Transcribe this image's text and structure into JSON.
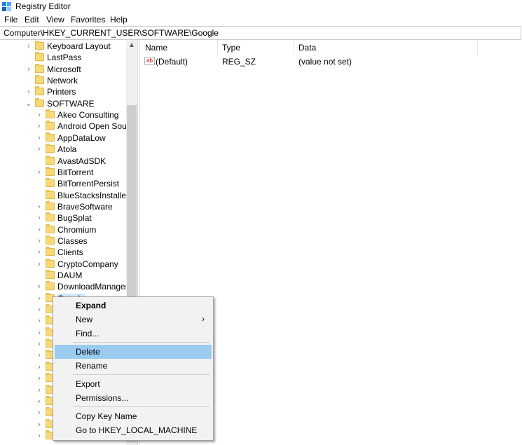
{
  "window": {
    "title": "Registry Editor"
  },
  "menu": [
    "File",
    "Edit",
    "View",
    "Favorites",
    "Help"
  ],
  "address": "Computer\\HKEY_CURRENT_USER\\SOFTWARE\\Google",
  "tree": {
    "top_items": [
      {
        "label": "Keyboard Layout",
        "expanded": false
      },
      {
        "label": "LastPass",
        "expanded": false,
        "no_children": true
      },
      {
        "label": "Microsoft",
        "expanded": false
      },
      {
        "label": "Network",
        "expanded": false,
        "no_children": true
      },
      {
        "label": "Printers",
        "expanded": false
      },
      {
        "label": "SOFTWARE",
        "expanded": true
      }
    ],
    "software_children": [
      {
        "label": "Akeo Consulting"
      },
      {
        "label": "Android Open Sourc"
      },
      {
        "label": "AppDataLow"
      },
      {
        "label": "Atola"
      },
      {
        "label": "AvastAdSDK",
        "no_children": true
      },
      {
        "label": "BitTorrent"
      },
      {
        "label": "BitTorrentPersist",
        "no_children": true
      },
      {
        "label": "BlueStacksInstaller",
        "no_children": true
      },
      {
        "label": "BraveSoftware"
      },
      {
        "label": "BugSplat"
      },
      {
        "label": "Chromium"
      },
      {
        "label": "Classes"
      },
      {
        "label": "Clients"
      },
      {
        "label": "CryptoCompany"
      },
      {
        "label": "DAUM",
        "no_children": true
      },
      {
        "label": "DownloadManager"
      },
      {
        "label": "Google",
        "selected": true
      }
    ],
    "hidden_rows": 12
  },
  "list": {
    "columns": [
      "Name",
      "Type",
      "Data"
    ],
    "rows": [
      {
        "icon": "string-value-icon",
        "icon_text": "ab",
        "name": "(Default)",
        "type": "REG_SZ",
        "data": "(value not set)"
      }
    ]
  },
  "context_menu": {
    "items": [
      {
        "label": "Expand",
        "bold": true
      },
      {
        "label": "New",
        "submenu": true
      },
      {
        "label": "Find..."
      },
      {
        "separator": true
      },
      {
        "label": "Delete",
        "highlighted": true
      },
      {
        "label": "Rename"
      },
      {
        "separator": true
      },
      {
        "label": "Export"
      },
      {
        "label": "Permissions..."
      },
      {
        "separator": true
      },
      {
        "label": "Copy Key Name"
      },
      {
        "label": "Go to HKEY_LOCAL_MACHINE"
      }
    ],
    "submenu_arrow": "›"
  },
  "icons": {
    "chevron_collapsed": "›",
    "chevron_expanded": "⌄",
    "scroll_up": "▲"
  },
  "colors": {
    "folder": "#f7d97a",
    "highlight": "#9ccbf0",
    "selection": "#cce8ff"
  }
}
